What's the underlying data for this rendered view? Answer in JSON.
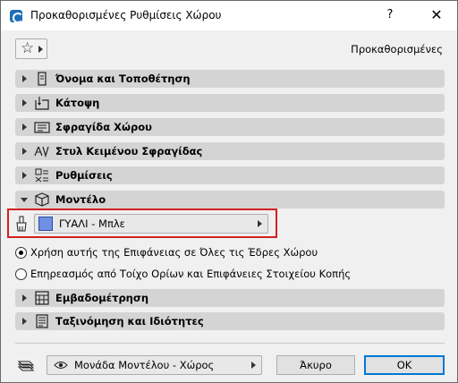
{
  "window": {
    "title": "Προκαθορισμένες Ρυθμίσεις Χώρου",
    "help_label": "?",
    "close_label": "✕"
  },
  "toolbar": {
    "favorites_icon": "star-icon",
    "defaults_label": "Προκαθορισμένες"
  },
  "panels": [
    {
      "label": "Όνομα και Τοποθέτηση",
      "icon": "name-position-icon",
      "expanded": false
    },
    {
      "label": "Κάτοψη",
      "icon": "floor-plan-icon",
      "expanded": false
    },
    {
      "label": "Σφραγίδα Χώρου",
      "icon": "zone-stamp-icon",
      "expanded": false
    },
    {
      "label": "Στυλ Κειμένου Σφραγίδας",
      "icon": "text-style-icon",
      "expanded": false
    },
    {
      "label": "Ρυθμίσεις",
      "icon": "settings-icon",
      "expanded": false
    },
    {
      "label": "Μοντέλο",
      "icon": "model-box-icon",
      "expanded": true
    },
    {
      "label": "Εμβαδομέτρηση",
      "icon": "area-calc-icon",
      "expanded": false
    },
    {
      "label": "Ταξινόμηση και Ιδιότητες",
      "icon": "classification-icon",
      "expanded": false
    }
  ],
  "model": {
    "surface_value": "ΓΥΑΛΙ - Μπλε",
    "surface_color": "#6f8fe0",
    "options": [
      {
        "label": "Χρήση αυτής της Επιφάνειας σε Όλες τις Έδρες Χώρου",
        "checked": true
      },
      {
        "label": "Επηρεασμός από Τοίχο Ορίων και Επιφάνειες Στοιχείου Κοπής",
        "checked": false
      }
    ]
  },
  "footer": {
    "layer_value": "Μονάδα Μοντέλου - Χώρος",
    "cancel_label": "Άκυρο",
    "ok_label": "OK"
  },
  "colors": {
    "highlight": "#d42020",
    "ok_border": "#0078d7"
  }
}
